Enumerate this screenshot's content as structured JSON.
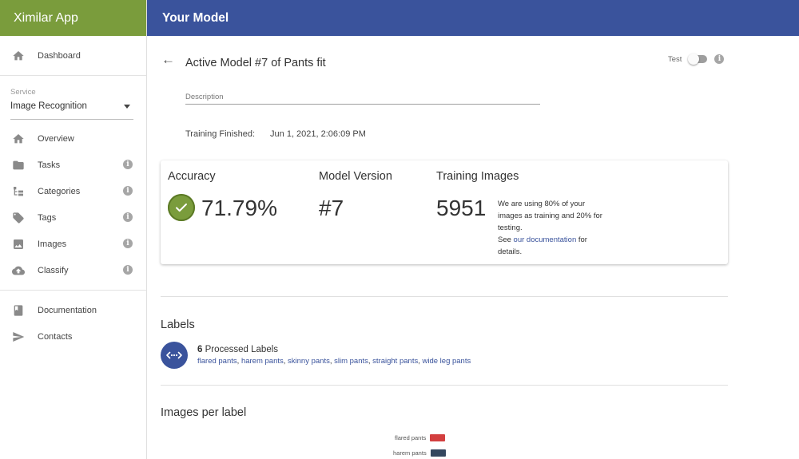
{
  "app": {
    "title": "Ximilar App"
  },
  "header": {
    "title": "Your Model"
  },
  "sidebar": {
    "dashboard": {
      "label": "Dashboard",
      "icon": "home-icon"
    },
    "service": {
      "label": "Service",
      "selected": "Image Recognition"
    },
    "items": [
      {
        "label": "Overview",
        "icon": "home-icon"
      },
      {
        "label": "Tasks",
        "icon": "folder-icon"
      },
      {
        "label": "Categories",
        "icon": "tree-icon"
      },
      {
        "label": "Tags",
        "icon": "tag-icon"
      },
      {
        "label": "Images",
        "icon": "image-icon"
      },
      {
        "label": "Classify",
        "icon": "cloud-upload-icon"
      }
    ],
    "footer": [
      {
        "label": "Documentation",
        "icon": "book-icon"
      },
      {
        "label": "Contacts",
        "icon": "send-icon"
      }
    ]
  },
  "model": {
    "title": "Active Model #7 of Pants fit",
    "test_label": "Test",
    "description_label": "Description",
    "training_finished_label": "Training Finished:",
    "training_finished_value": "Jun 1, 2021, 2:06:09 PM"
  },
  "stats": {
    "accuracy_label": "Accuracy",
    "accuracy_value": "71.79%",
    "version_label": "Model Version",
    "version_value": "#7",
    "images_label": "Training Images",
    "images_value": "5951",
    "note_line1": "We are using 80% of your images as training and 20% for testing.",
    "note_see": "See ",
    "note_link": "our documentation",
    "note_end": " for details."
  },
  "labels_section": {
    "title": "Labels",
    "count": "6",
    "count_suffix": " Processed Labels",
    "labels": [
      "flared pants",
      "harem pants",
      "skinny pants",
      "slim pants",
      "straight pants",
      "wide leg pants"
    ]
  },
  "images_per_label": {
    "title": "Images per label",
    "legend": [
      {
        "label": "flared pants",
        "color": "#d33f3f"
      },
      {
        "label": "harem pants",
        "color": "#34475e"
      }
    ]
  },
  "colors": {
    "brand_green": "#7a9c3c",
    "header_blue": "#3a539c"
  }
}
